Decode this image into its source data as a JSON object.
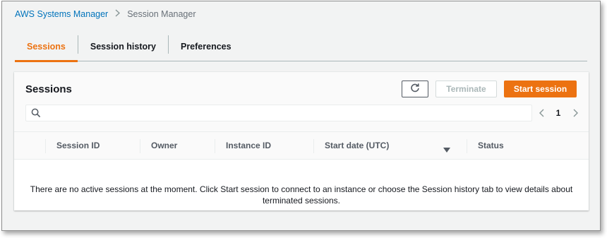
{
  "breadcrumb": {
    "parent": "AWS Systems Manager",
    "current": "Session Manager"
  },
  "tabs": [
    {
      "label": "Sessions",
      "active": true
    },
    {
      "label": "Session history",
      "active": false
    },
    {
      "label": "Preferences",
      "active": false
    }
  ],
  "panel": {
    "title": "Sessions",
    "refresh_icon": "refresh-icon",
    "terminate_label": "Terminate",
    "start_label": "Start session",
    "search_placeholder": "",
    "page_number": "1"
  },
  "table": {
    "columns": [
      "Session ID",
      "Owner",
      "Instance ID",
      "Start date (UTC)",
      "Status"
    ],
    "sort_icon": "caret-down-icon",
    "empty_message": "There are no active sessions at the moment. Click Start session to connect to an instance or choose the Session history tab to view details about terminated sessions."
  },
  "colors": {
    "accent": "#ec7211",
    "link": "#0073bb"
  }
}
